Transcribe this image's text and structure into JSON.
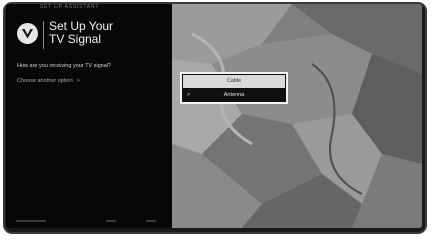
{
  "screen": {
    "top_caption": "SET UP ASSISTANT",
    "title_line1": "Set Up Your",
    "title_line2": "TV Signal",
    "question": "How are you receiving your TV signal?",
    "other_option": "Choose another option",
    "other_option_chevron": ">"
  },
  "options": [
    {
      "label": "Cable",
      "selected": true
    },
    {
      "label": "Antenna",
      "selected": false,
      "chevron": ">"
    }
  ],
  "colors": {
    "panel_bg": "#070707",
    "selected_bg": "#d9d9d9",
    "focus_border": "#f4f4f4"
  },
  "icons": {
    "logo": "vizio-v-logo-icon"
  }
}
